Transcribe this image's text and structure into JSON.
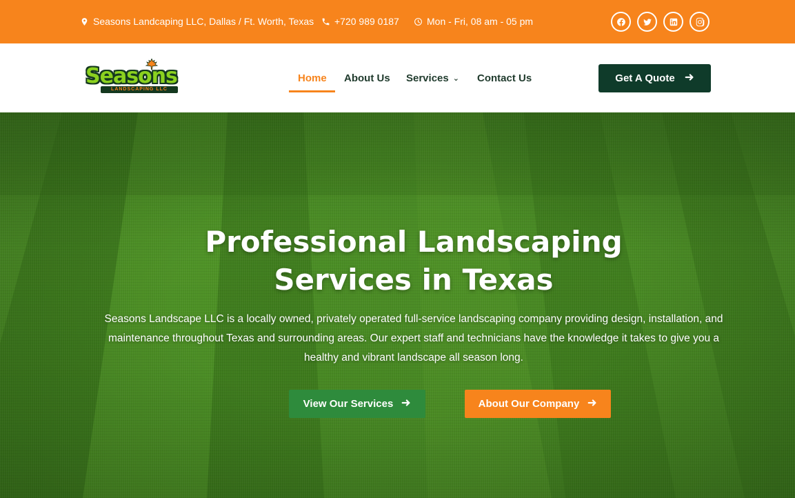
{
  "topbar": {
    "address": "Seasons Landcaping LLC, Dallas / Ft. Worth, Texas",
    "phone": "+720 989 0187",
    "hours": "Mon - Fri, 08 am - 05 pm",
    "social": [
      "facebook-icon",
      "twitter-icon",
      "linkedin-icon",
      "instagram-icon"
    ]
  },
  "logo": {
    "main": "Seasons",
    "sub": "LANDSCAPING LLC"
  },
  "nav": {
    "items": [
      {
        "label": "Home",
        "active": true
      },
      {
        "label": "About Us",
        "active": false
      },
      {
        "label": "Services",
        "active": false,
        "dropdown": true
      },
      {
        "label": "Contact Us",
        "active": false
      }
    ],
    "cta": "Get A Quote"
  },
  "hero": {
    "title_line1": "Professional Landscaping",
    "title_line2": "Services in Texas",
    "description": "Seasons Landscape LLC is a locally owned, privately operated full-service landscaping company providing design, installation, and maintenance throughout Texas and surrounding areas. Our expert staff and technicians have the knowledge it takes to give you a healthy and vibrant landscape all season long.",
    "primary_button": "View Our Services",
    "secondary_button": "About Our Company"
  },
  "colors": {
    "accent_orange": "#f7841c",
    "dark_green": "#0f3b2a",
    "button_green": "#2e8b3c",
    "logo_green": "#8bd11f"
  }
}
